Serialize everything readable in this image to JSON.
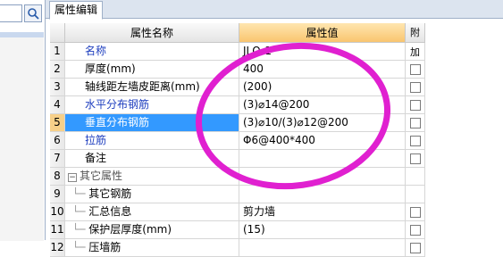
{
  "search": {
    "placeholder": ""
  },
  "tab": {
    "label": "属性编辑"
  },
  "columns": {
    "name": "属性名称",
    "value": "属性值",
    "add": "附加"
  },
  "rows": [
    {
      "num": "1",
      "name": "名称",
      "value": "JLQ-1",
      "style": "blue",
      "checkbox": false
    },
    {
      "num": "2",
      "name": "厚度(mm)",
      "value": "400",
      "style": "black",
      "checkbox": true
    },
    {
      "num": "3",
      "name": "轴线距左墙皮距离(mm)",
      "value": "(200)",
      "style": "black",
      "checkbox": true
    },
    {
      "num": "4",
      "name": "水平分布钢筋",
      "value": "(3)⌀14@200",
      "style": "blue",
      "checkbox": true
    },
    {
      "num": "5",
      "name": "垂直分布钢筋",
      "value": "(3)⌀10/(3)⌀12@200",
      "style": "selected",
      "checkbox": true
    },
    {
      "num": "6",
      "name": "拉筋",
      "value": "Φ6@400*400",
      "style": "blue",
      "checkbox": true
    },
    {
      "num": "7",
      "name": "备注",
      "value": "",
      "style": "black",
      "checkbox": true
    },
    {
      "num": "8",
      "name": "其它属性",
      "value": "",
      "style": "group",
      "checkbox": false
    },
    {
      "num": "9",
      "name": "其它钢筋",
      "value": "",
      "style": "child",
      "checkbox": false
    },
    {
      "num": "10",
      "name": "汇总信息",
      "value": "剪力墙",
      "style": "child",
      "checkbox": true
    },
    {
      "num": "11",
      "name": "保护层厚度(mm)",
      "value": "(15)",
      "style": "child",
      "checkbox": true
    },
    {
      "num": "12",
      "name": "压墙筋",
      "value": "",
      "style": "child",
      "checkbox": true
    }
  ],
  "colors": {
    "selection": "#3399ff",
    "name_link": "#1f3fbf",
    "annotation": "#e020d0",
    "header_highlight": "#f9c56f"
  }
}
